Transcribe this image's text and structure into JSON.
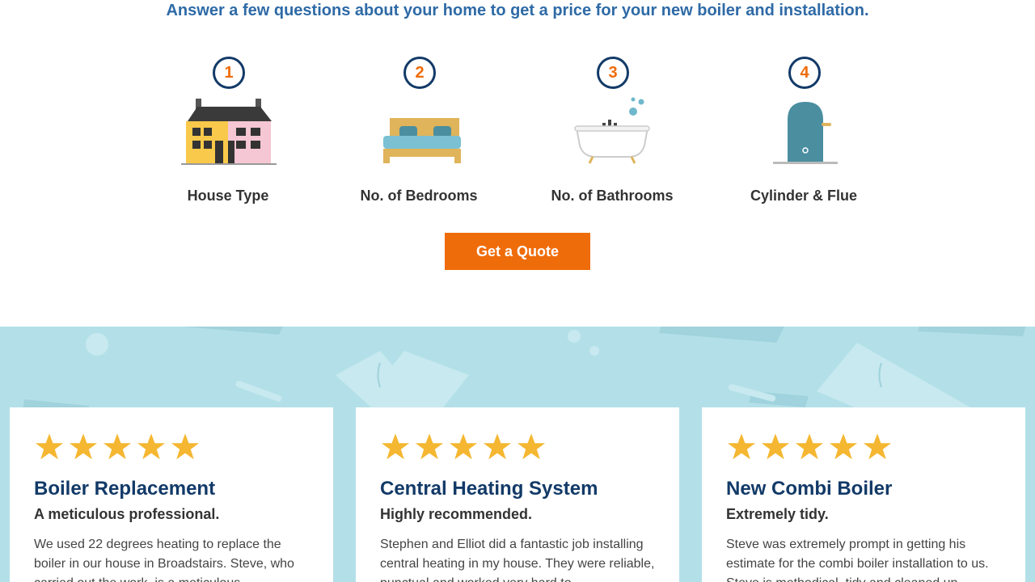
{
  "intro": {
    "text": "Answer a few questions about your home to get a price for your new boiler and installation."
  },
  "steps": [
    {
      "number": "1",
      "label": "House Type",
      "icon": "house-icon"
    },
    {
      "number": "2",
      "label": "No. of Bedrooms",
      "icon": "bed-icon"
    },
    {
      "number": "3",
      "label": "No. of Bathrooms",
      "icon": "bathtub-icon"
    },
    {
      "number": "4",
      "label": "Cylinder & Flue",
      "icon": "cylinder-icon"
    }
  ],
  "cta": {
    "label": "Get a Quote"
  },
  "colors": {
    "accent": "#ef6c0a",
    "navy": "#123a68",
    "intro_blue": "#2e6aa6",
    "band": "#b3e0e8",
    "star": "#f5b731"
  },
  "reviews": [
    {
      "rating": 5,
      "title": "Boiler Replacement",
      "subtitle": "A meticulous professional.",
      "body": "We used 22 degrees heating to replace the boiler in our house in Broadstairs. Steve, who carried out the work, is a meticulous"
    },
    {
      "rating": 5,
      "title": "Central Heating System",
      "subtitle": "Highly recommended.",
      "body": "Stephen and Elliot did a fantastic job installing central heating in my house. They were reliable, punctual and worked very hard to"
    },
    {
      "rating": 5,
      "title": "New Combi Boiler",
      "subtitle": "Extremely tidy.",
      "body": "Steve was extremely prompt in getting his estimate for the combi boiler installation to us. Steve is methodical, tidy and cleaned up"
    }
  ]
}
